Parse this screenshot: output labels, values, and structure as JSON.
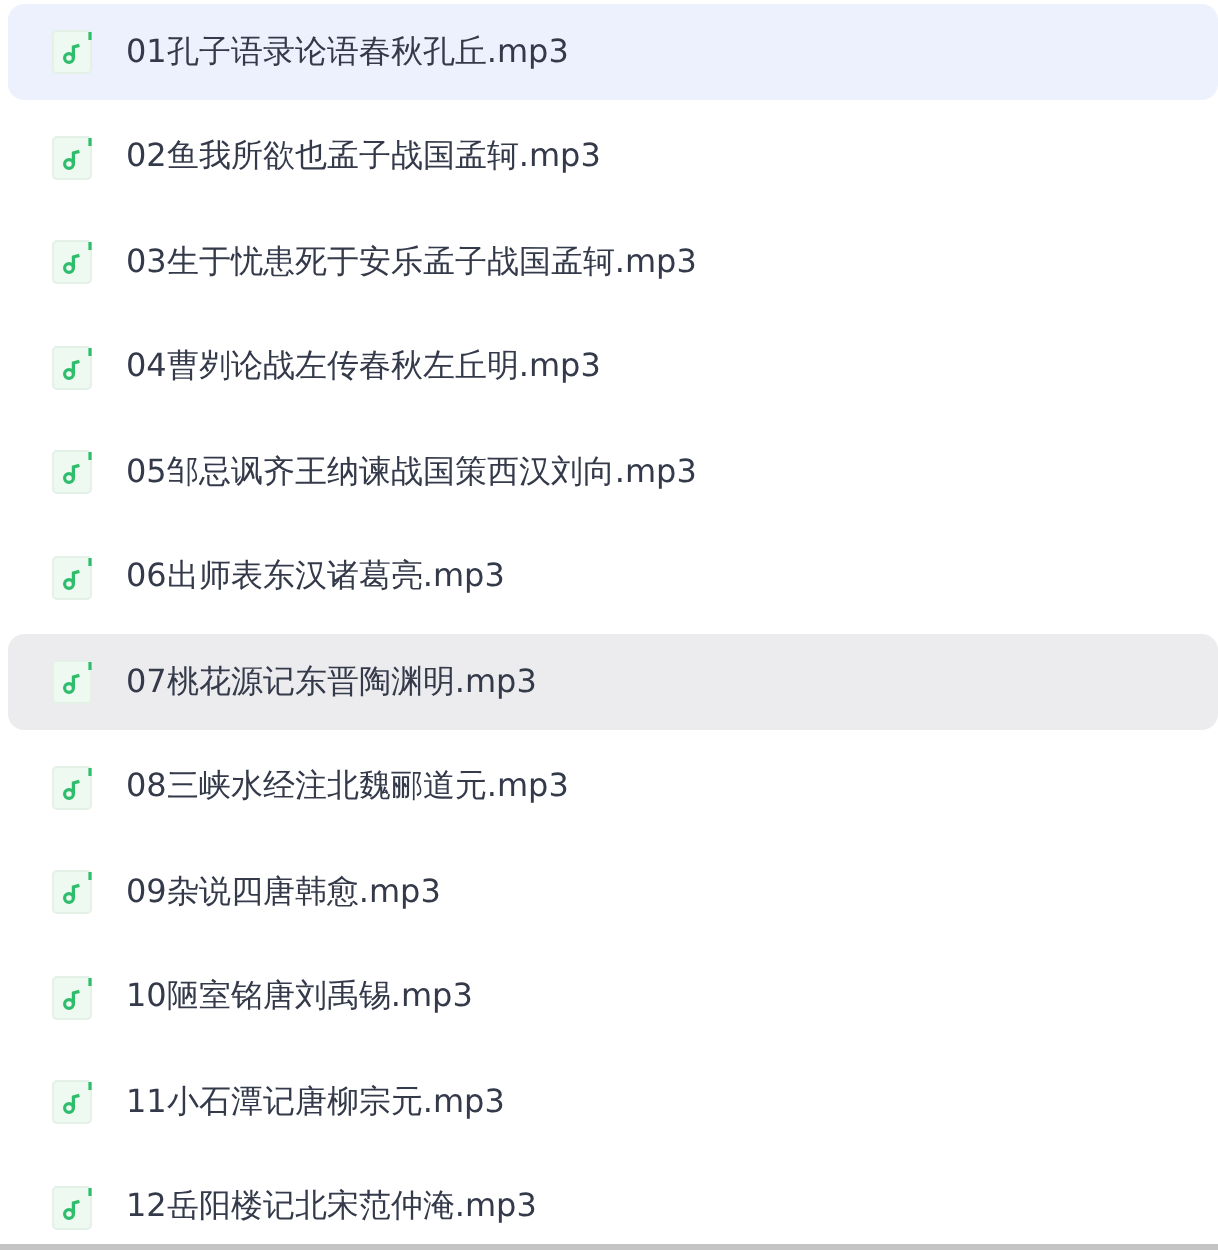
{
  "files": [
    {
      "name": "01孔子语录论语春秋孔丘.mp3",
      "selected": true,
      "hovered": false
    },
    {
      "name": "02鱼我所欲也孟子战国孟轲.mp3",
      "selected": false,
      "hovered": false
    },
    {
      "name": "03生于忧患死于安乐孟子战国孟轲.mp3",
      "selected": false,
      "hovered": false
    },
    {
      "name": "04曹刿论战左传春秋左丘明.mp3",
      "selected": false,
      "hovered": false
    },
    {
      "name": "05邹忌讽齐王纳谏战国策西汉刘向.mp3",
      "selected": false,
      "hovered": false
    },
    {
      "name": "06出师表东汉诸葛亮.mp3",
      "selected": false,
      "hovered": false
    },
    {
      "name": "07桃花源记东晋陶渊明.mp3",
      "selected": false,
      "hovered": true
    },
    {
      "name": "08三峡水经注北魏郦道元.mp3",
      "selected": false,
      "hovered": false
    },
    {
      "name": "09杂说四唐韩愈.mp3",
      "selected": false,
      "hovered": false
    },
    {
      "name": "10陋室铭唐刘禹锡.mp3",
      "selected": false,
      "hovered": false
    },
    {
      "name": "11小石潭记唐柳宗元.mp3",
      "selected": false,
      "hovered": false
    },
    {
      "name": "12岳阳楼记北宋范仲淹.mp3",
      "selected": false,
      "hovered": false
    }
  ]
}
